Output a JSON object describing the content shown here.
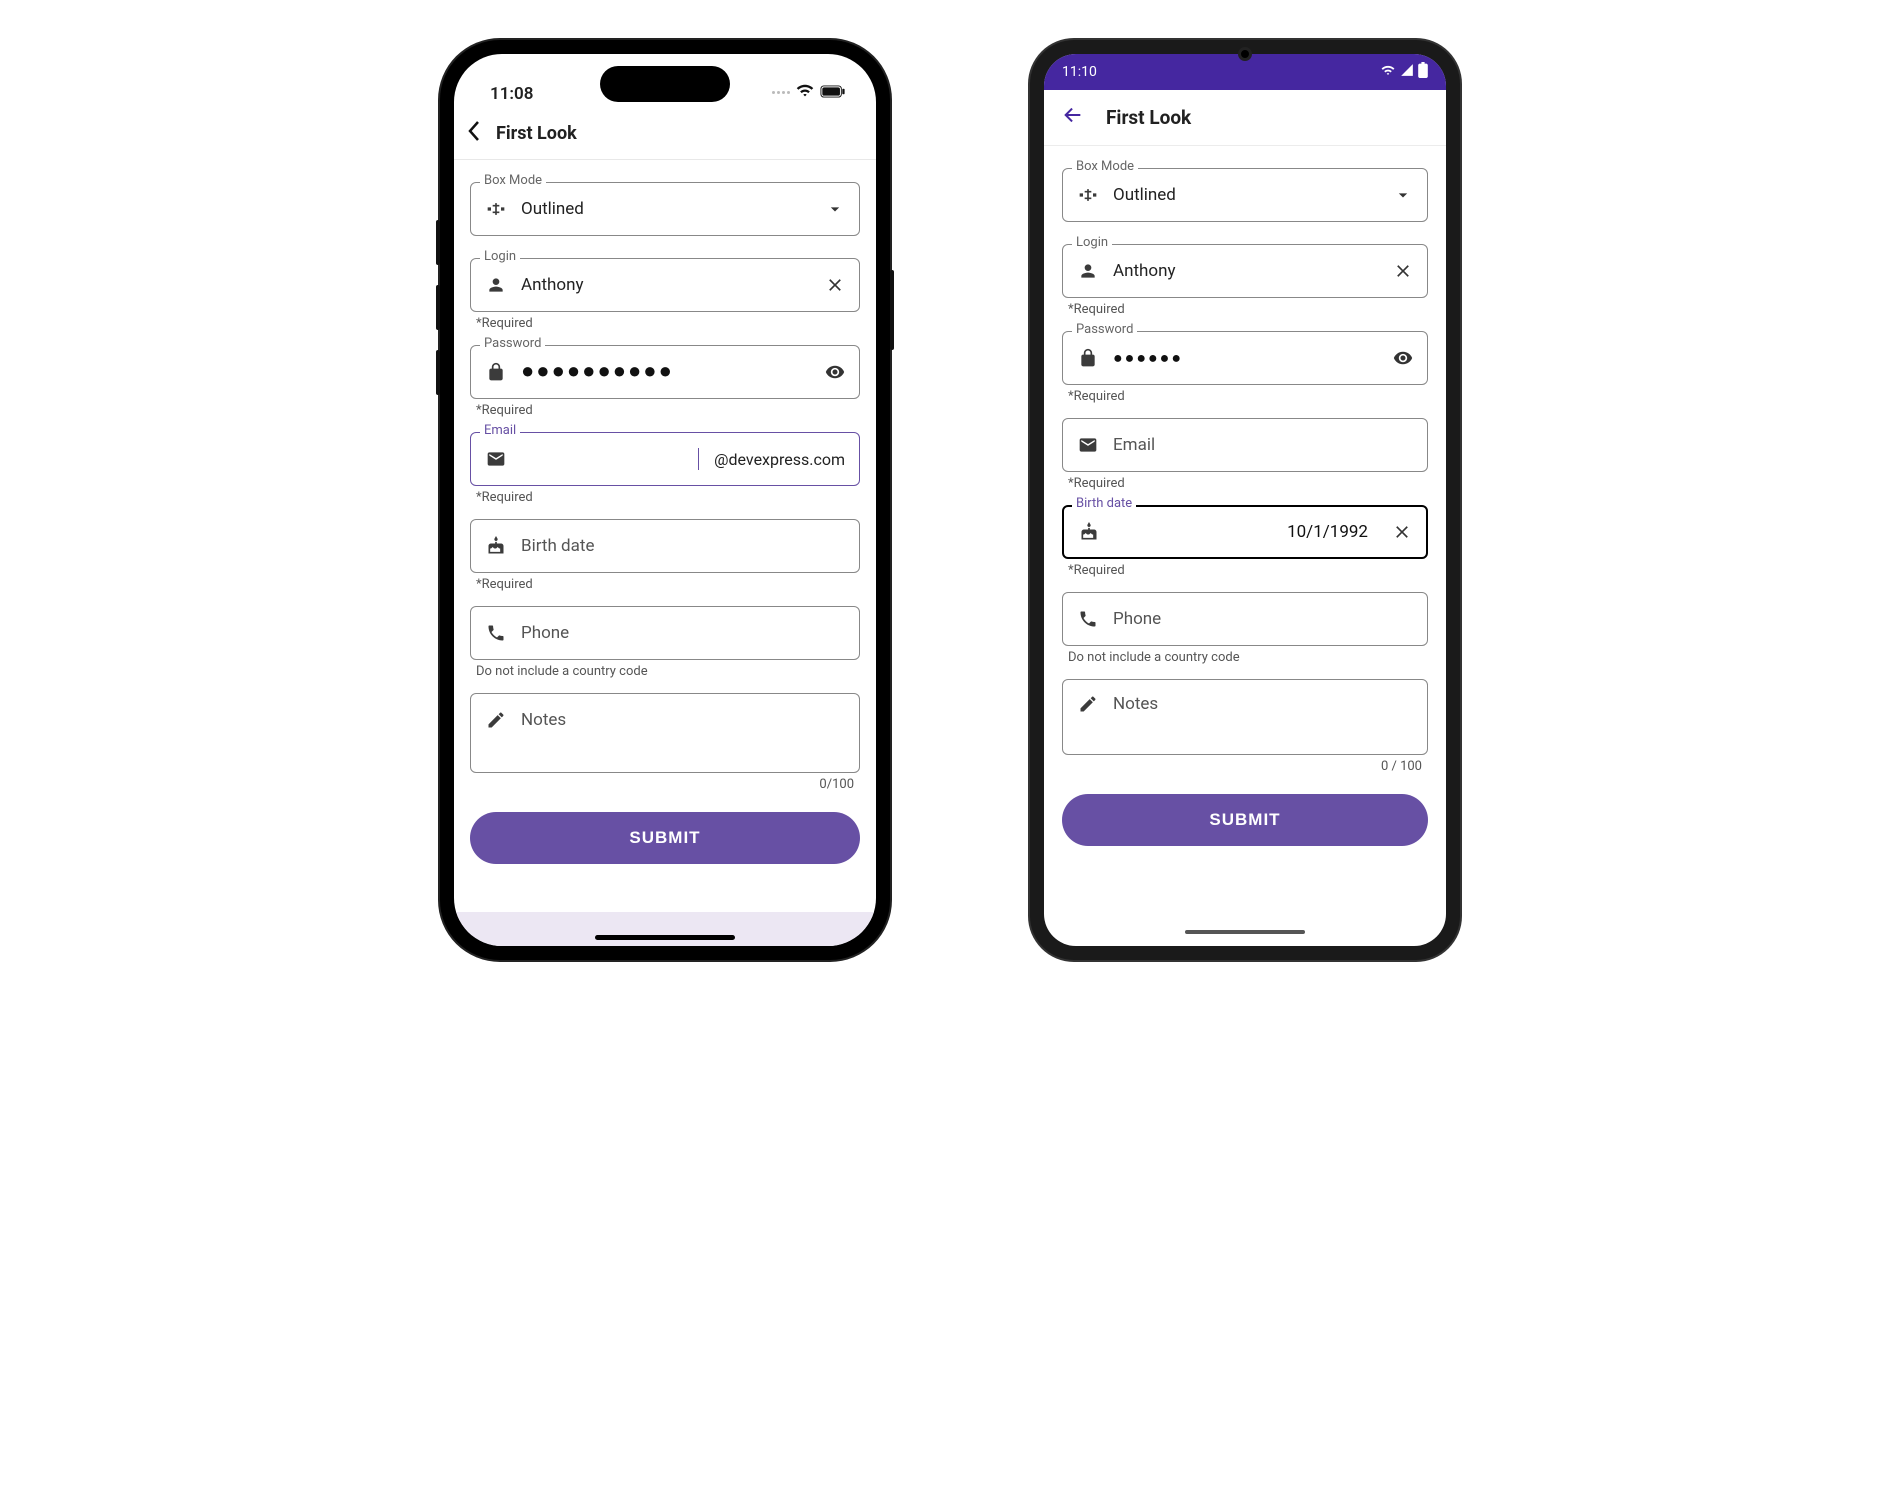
{
  "ios": {
    "status": {
      "time": "11:08"
    },
    "nav": {
      "title": "First Look"
    },
    "box_mode": {
      "label": "Box Mode",
      "value": "Outlined"
    },
    "login": {
      "label": "Login",
      "value": "Anthony",
      "helper": "*Required"
    },
    "password": {
      "label": "Password",
      "value": "●●●●●●●●●●",
      "helper": "*Required"
    },
    "email": {
      "label": "Email",
      "suffix": "@devexpress.com",
      "helper": "*Required"
    },
    "birth": {
      "placeholder": "Birth date",
      "helper": "*Required"
    },
    "phone": {
      "placeholder": "Phone",
      "helper": "Do not include a country code"
    },
    "notes": {
      "placeholder": "Notes",
      "counter": "0/100"
    },
    "submit": "SUBMIT"
  },
  "android": {
    "status": {
      "time": "11:10"
    },
    "nav": {
      "title": "First Look"
    },
    "box_mode": {
      "label": "Box Mode",
      "value": "Outlined"
    },
    "login": {
      "label": "Login",
      "value": "Anthony",
      "helper": "*Required"
    },
    "password": {
      "label": "Password",
      "value": "●●●●●●",
      "helper": "*Required"
    },
    "email": {
      "placeholder": "Email",
      "helper": "*Required"
    },
    "birth": {
      "label": "Birth date",
      "value": "10/1/1992",
      "helper": "*Required"
    },
    "phone": {
      "placeholder": "Phone",
      "helper": "Do not include a country code"
    },
    "notes": {
      "placeholder": "Notes",
      "counter": "0 / 100"
    },
    "submit": "SUBMIT"
  }
}
